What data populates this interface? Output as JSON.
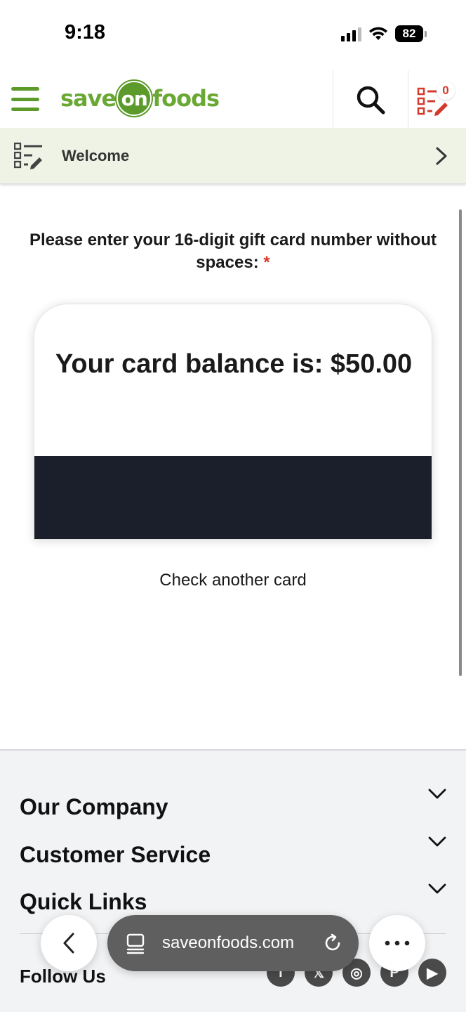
{
  "status_bar": {
    "time": "9:18",
    "battery": "82",
    "icons": [
      "signal-icon",
      "wifi-icon",
      "battery-icon"
    ]
  },
  "header": {
    "logo_parts": [
      "save",
      "on",
      "foods"
    ],
    "search_icon": "search-icon",
    "list_icon": "shopping-list-icon",
    "list_count": "0",
    "colors": {
      "brand_green": "#5c9b2b",
      "accent_red": "#d33a2c"
    }
  },
  "welcome_bar": {
    "label": "Welcome",
    "icon": "list-edit-icon"
  },
  "gift_card": {
    "prompt": "Please enter your 16-digit gift card number without spaces:",
    "required_marker": "*",
    "balance_text": "Your card balance is: $50.00",
    "check_another": "Check another card",
    "band_color": "#1b1f2b"
  },
  "footer": {
    "sections": [
      "Our Company",
      "Customer Service",
      "Quick Links"
    ],
    "follow_label": "Follow Us",
    "social": [
      "facebook-icon",
      "x-icon",
      "instagram-icon",
      "pinterest-icon",
      "youtube-icon"
    ],
    "social_glyphs": [
      "f",
      "𝕏",
      "◎",
      "P",
      "▶"
    ]
  },
  "browser": {
    "url": "saveonfoods.com",
    "back_icon": "back-chevron-icon",
    "more_icon": "more-icon",
    "reload_icon": "reload-icon"
  }
}
